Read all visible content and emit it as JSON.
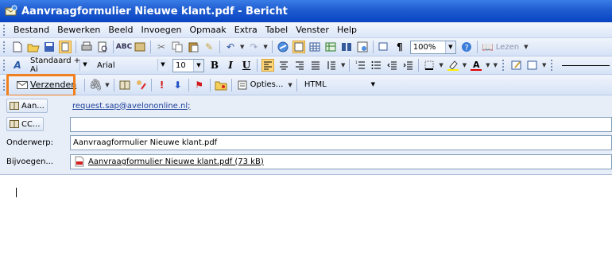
{
  "window": {
    "title": "Aanvraagformulier Nieuwe klant.pdf - Bericht"
  },
  "menu": [
    "Bestand",
    "Bewerken",
    "Beeld",
    "Invoegen",
    "Opmaak",
    "Extra",
    "Tabel",
    "Venster",
    "Help"
  ],
  "toolbar_standard": {
    "zoom": "100%",
    "read_label": "Lezen"
  },
  "toolbar_format": {
    "style": "Standaard + Ai",
    "font": "Arial",
    "size": "10",
    "bold": "B",
    "italic": "I",
    "underline": "U"
  },
  "toolbar_mail": {
    "send_label": "Verzenden",
    "options_label": "Opties...",
    "format": "HTML"
  },
  "fields": {
    "to_label": "Aan...",
    "to_value": "request.sap@avelononline.nl;",
    "cc_label": "CC...",
    "cc_value": "",
    "subject_label": "Onderwerp:",
    "subject_value": "Aanvraagformulier Nieuwe klant.pdf",
    "attach_label": "Bijvoegen...",
    "attach_value": "Aanvraagformulier Nieuwe klant.pdf (73 kB)"
  },
  "colors": {
    "title_bar": "#1e5bd0",
    "highlight": "#f07f1d",
    "active_button": "#ffd77a"
  }
}
